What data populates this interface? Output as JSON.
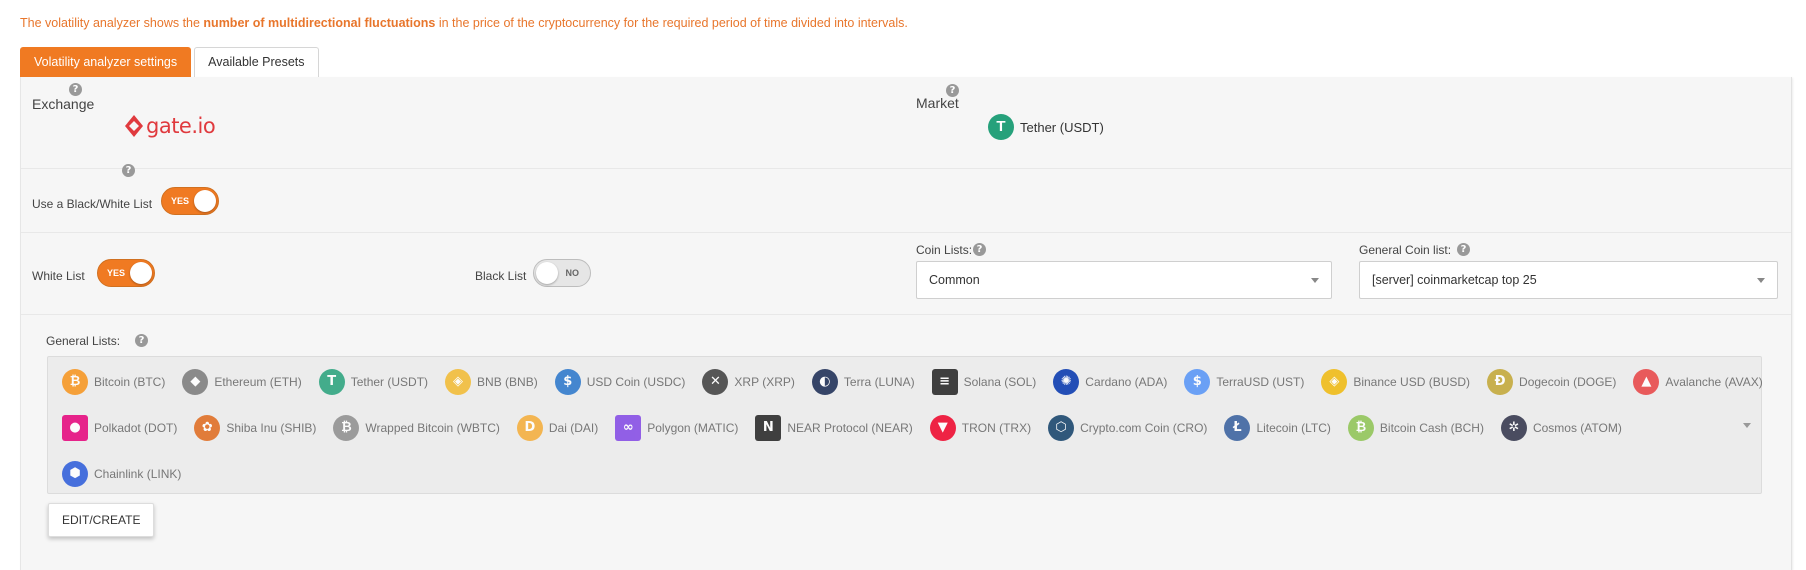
{
  "intro": {
    "before": "The volatility analyzer shows the ",
    "bold": "number of multidirectional fluctuations",
    "after": " in the price of the cryptocurrency for the required period of time divided into intervals."
  },
  "tabs": [
    {
      "label": "Volatility analyzer settings",
      "active": true
    },
    {
      "label": "Available Presets",
      "active": false
    }
  ],
  "exchange": {
    "label": "Exchange",
    "help": "?",
    "logo_text": "gate.io"
  },
  "market": {
    "label": "Market",
    "help": "?",
    "value": "Tether (USDT)",
    "icon": "tether-icon",
    "icon_glyph": "T"
  },
  "blackwhite": {
    "label": "Use a Black/White List",
    "help": "?",
    "toggle": "YES"
  },
  "whitelist": {
    "label": "White List",
    "toggle": "YES"
  },
  "blacklist": {
    "label": "Black List",
    "toggle": "NO"
  },
  "coin_lists": {
    "label": "Coin Lists:",
    "help": "?",
    "value": "Common"
  },
  "general_coin_list": {
    "label": "General Coin list:",
    "help": "?",
    "value": "[server] coinmarketcap top 25"
  },
  "general_lists": {
    "label": "General Lists:",
    "help": "?",
    "rows": [
      [
        {
          "name": "Bitcoin (BTC)",
          "icon": "bitcoin-icon",
          "glyph": "₿",
          "color": "#f7931a"
        },
        {
          "name": "Ethereum (ETH)",
          "icon": "ethereum-icon",
          "glyph": "◆",
          "color": "#7a7a7a"
        },
        {
          "name": "Tether (USDT)",
          "icon": "tether-icon",
          "glyph": "T",
          "color": "#26a17b"
        },
        {
          "name": "BNB (BNB)",
          "icon": "bnb-icon",
          "glyph": "◈",
          "color": "#f3ba2f"
        },
        {
          "name": "USD Coin (USDC)",
          "icon": "usdc-icon",
          "glyph": "$",
          "color": "#2775ca"
        },
        {
          "name": "XRP (XRP)",
          "icon": "xrp-icon",
          "glyph": "✕",
          "color": "#3d3d3d"
        },
        {
          "name": "Terra (LUNA)",
          "icon": "terra-icon",
          "glyph": "◐",
          "color": "#172852"
        },
        {
          "name": "Solana (SOL)",
          "icon": "solana-icon",
          "glyph": "≡",
          "color": "#222222"
        },
        {
          "name": "Cardano (ADA)",
          "icon": "cardano-icon",
          "glyph": "✺",
          "color": "#0033ad"
        },
        {
          "name": "TerraUSD (UST)",
          "icon": "terrausd-icon",
          "glyph": "$",
          "color": "#5493f7"
        },
        {
          "name": "Binance USD (BUSD)",
          "icon": "busd-icon",
          "glyph": "◈",
          "color": "#f0b90b"
        },
        {
          "name": "Dogecoin (DOGE)",
          "icon": "dogecoin-icon",
          "glyph": "Ð",
          "color": "#c2a633"
        },
        {
          "name": "Avalanche (AVAX)",
          "icon": "avalanche-icon",
          "glyph": "▲",
          "color": "#e84142"
        }
      ],
      [
        {
          "name": "Polkadot (DOT)",
          "icon": "polkadot-icon",
          "glyph": "●",
          "color": "#e6007a"
        },
        {
          "name": "Shiba Inu (SHIB)",
          "icon": "shiba-icon",
          "glyph": "✿",
          "color": "#e0691b"
        },
        {
          "name": "Wrapped Bitcoin (WBTC)",
          "icon": "wbtc-icon",
          "glyph": "₿",
          "color": "#8e8e8e"
        },
        {
          "name": "Dai (DAI)",
          "icon": "dai-icon",
          "glyph": "D",
          "color": "#f5ac37"
        },
        {
          "name": "Polygon (MATIC)",
          "icon": "polygon-icon",
          "glyph": "∞",
          "color": "#8247e5"
        },
        {
          "name": "NEAR Protocol (NEAR)",
          "icon": "near-icon",
          "glyph": "N",
          "color": "#222222"
        },
        {
          "name": "TRON (TRX)",
          "icon": "tron-icon",
          "glyph": "▼",
          "color": "#ef0027"
        },
        {
          "name": "Crypto.com Coin (CRO)",
          "icon": "cro-icon",
          "glyph": "⬡",
          "color": "#103f68"
        },
        {
          "name": "Litecoin (LTC)",
          "icon": "litecoin-icon",
          "glyph": "Ł",
          "color": "#345d9d"
        },
        {
          "name": "Bitcoin Cash (BCH)",
          "icon": "bitcoin-cash-icon",
          "glyph": "₿",
          "color": "#8dc351"
        },
        {
          "name": "Cosmos (ATOM)",
          "icon": "cosmos-icon",
          "glyph": "✲",
          "color": "#2e3148"
        }
      ],
      [
        {
          "name": "Chainlink (LINK)",
          "icon": "chainlink-icon",
          "glyph": "⬢",
          "color": "#2a5ada"
        }
      ]
    ]
  },
  "edit_button": {
    "label": "EDIT/CREATE"
  }
}
